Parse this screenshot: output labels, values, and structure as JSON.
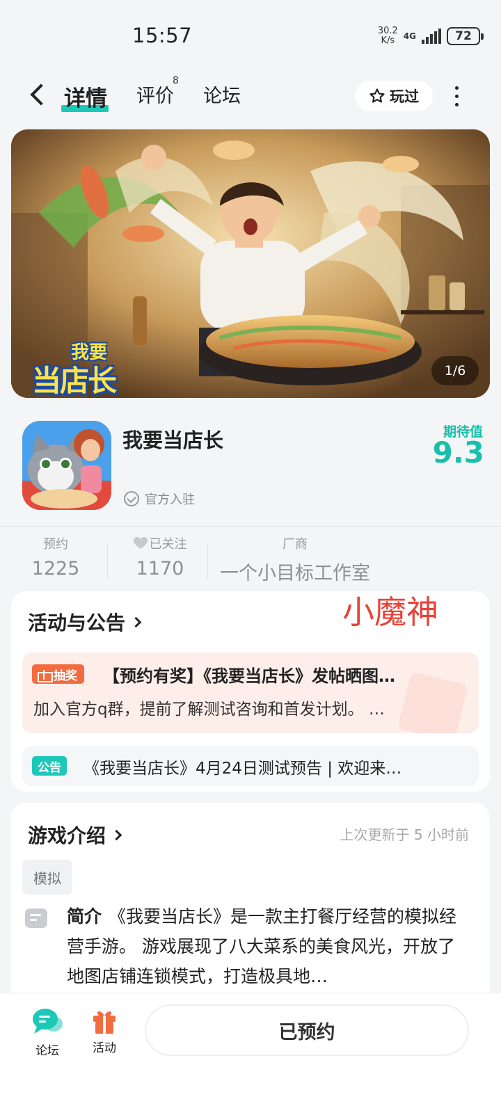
{
  "status_bar": {
    "time": "15:57",
    "net_speed_top": "30.2",
    "net_speed_bottom": "K/s",
    "network": "4G",
    "battery": "72"
  },
  "nav": {
    "tabs": [
      {
        "label": "详情",
        "active": true
      },
      {
        "label": "评价",
        "badge": "8"
      },
      {
        "label": "论坛"
      }
    ],
    "played_label": "玩过"
  },
  "banner": {
    "logo_line1": "我要",
    "logo_line2": "当店长",
    "counter": "1/6"
  },
  "game": {
    "name": "我要当店长",
    "official_label": "官方入驻",
    "expect_label": "期待值",
    "expect_score": "9.3"
  },
  "stats": [
    {
      "label": "预约",
      "value": "1225"
    },
    {
      "label": "已关注",
      "value": "1170",
      "icon": "heart-icon"
    },
    {
      "label": "厂商",
      "value": "一个小目标工作室"
    }
  ],
  "activities": {
    "title": "活动与公告",
    "watermark": "小魔神",
    "promo": {
      "badge": "抽奖",
      "title": "【预约有奖】《我要当店长》发帖晒图…",
      "text": "加入官方q群，提前了解测试咨询和首发计划。 …"
    },
    "notice": {
      "badge": "公告",
      "text": "《我要当店长》4月24日测试预告 | 欢迎来…"
    }
  },
  "intro": {
    "title": "游戏介绍",
    "updated": "上次更新于 5 小时前",
    "tag": "模拟",
    "label": "简介",
    "text": "《我要当店长》是一款主打餐厅经营的模拟经营手游。 游戏展现了八大菜系的美食风光，开放了地图店铺连锁模式，打造极具地…"
  },
  "bottom_bar": {
    "forum_label": "论坛",
    "activity_label": "活动",
    "reserve_label": "已预约"
  },
  "colors": {
    "accent": "#1ec8b8",
    "score": "#18bfaa",
    "lottery": "#f36c3f",
    "watermark": "#e8433a"
  }
}
